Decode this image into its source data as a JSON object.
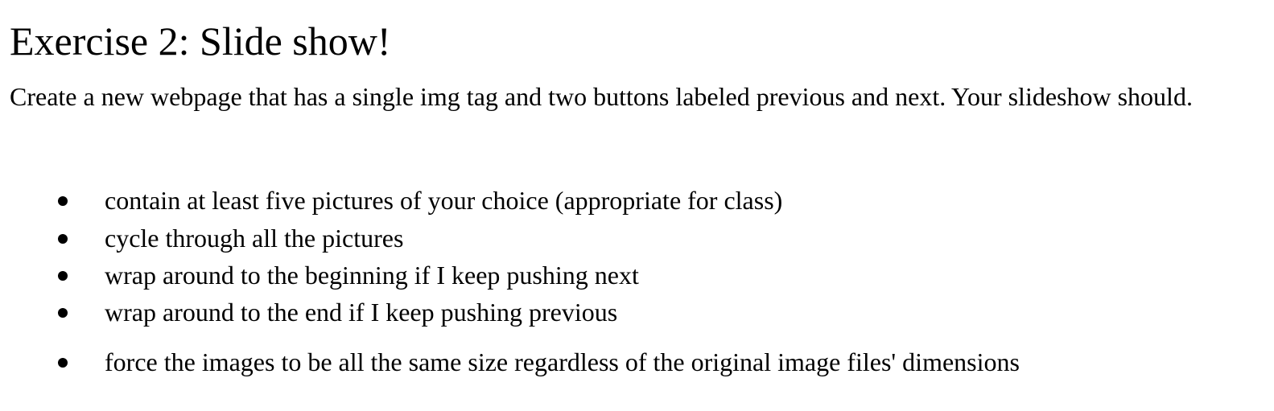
{
  "document": {
    "title": "Exercise 2: Slide show!",
    "intro": "Create a new webpage that has a single img tag and two buttons labeled previous and next. Your slideshow should.",
    "requirements": [
      "contain at least five pictures of your choice (appropriate for class)",
      "cycle through all the pictures",
      "wrap around to the beginning if I keep pushing next",
      "wrap around to the end if I keep pushing previous",
      "force the images to be all the same size regardless of the original image files' dimensions"
    ]
  }
}
